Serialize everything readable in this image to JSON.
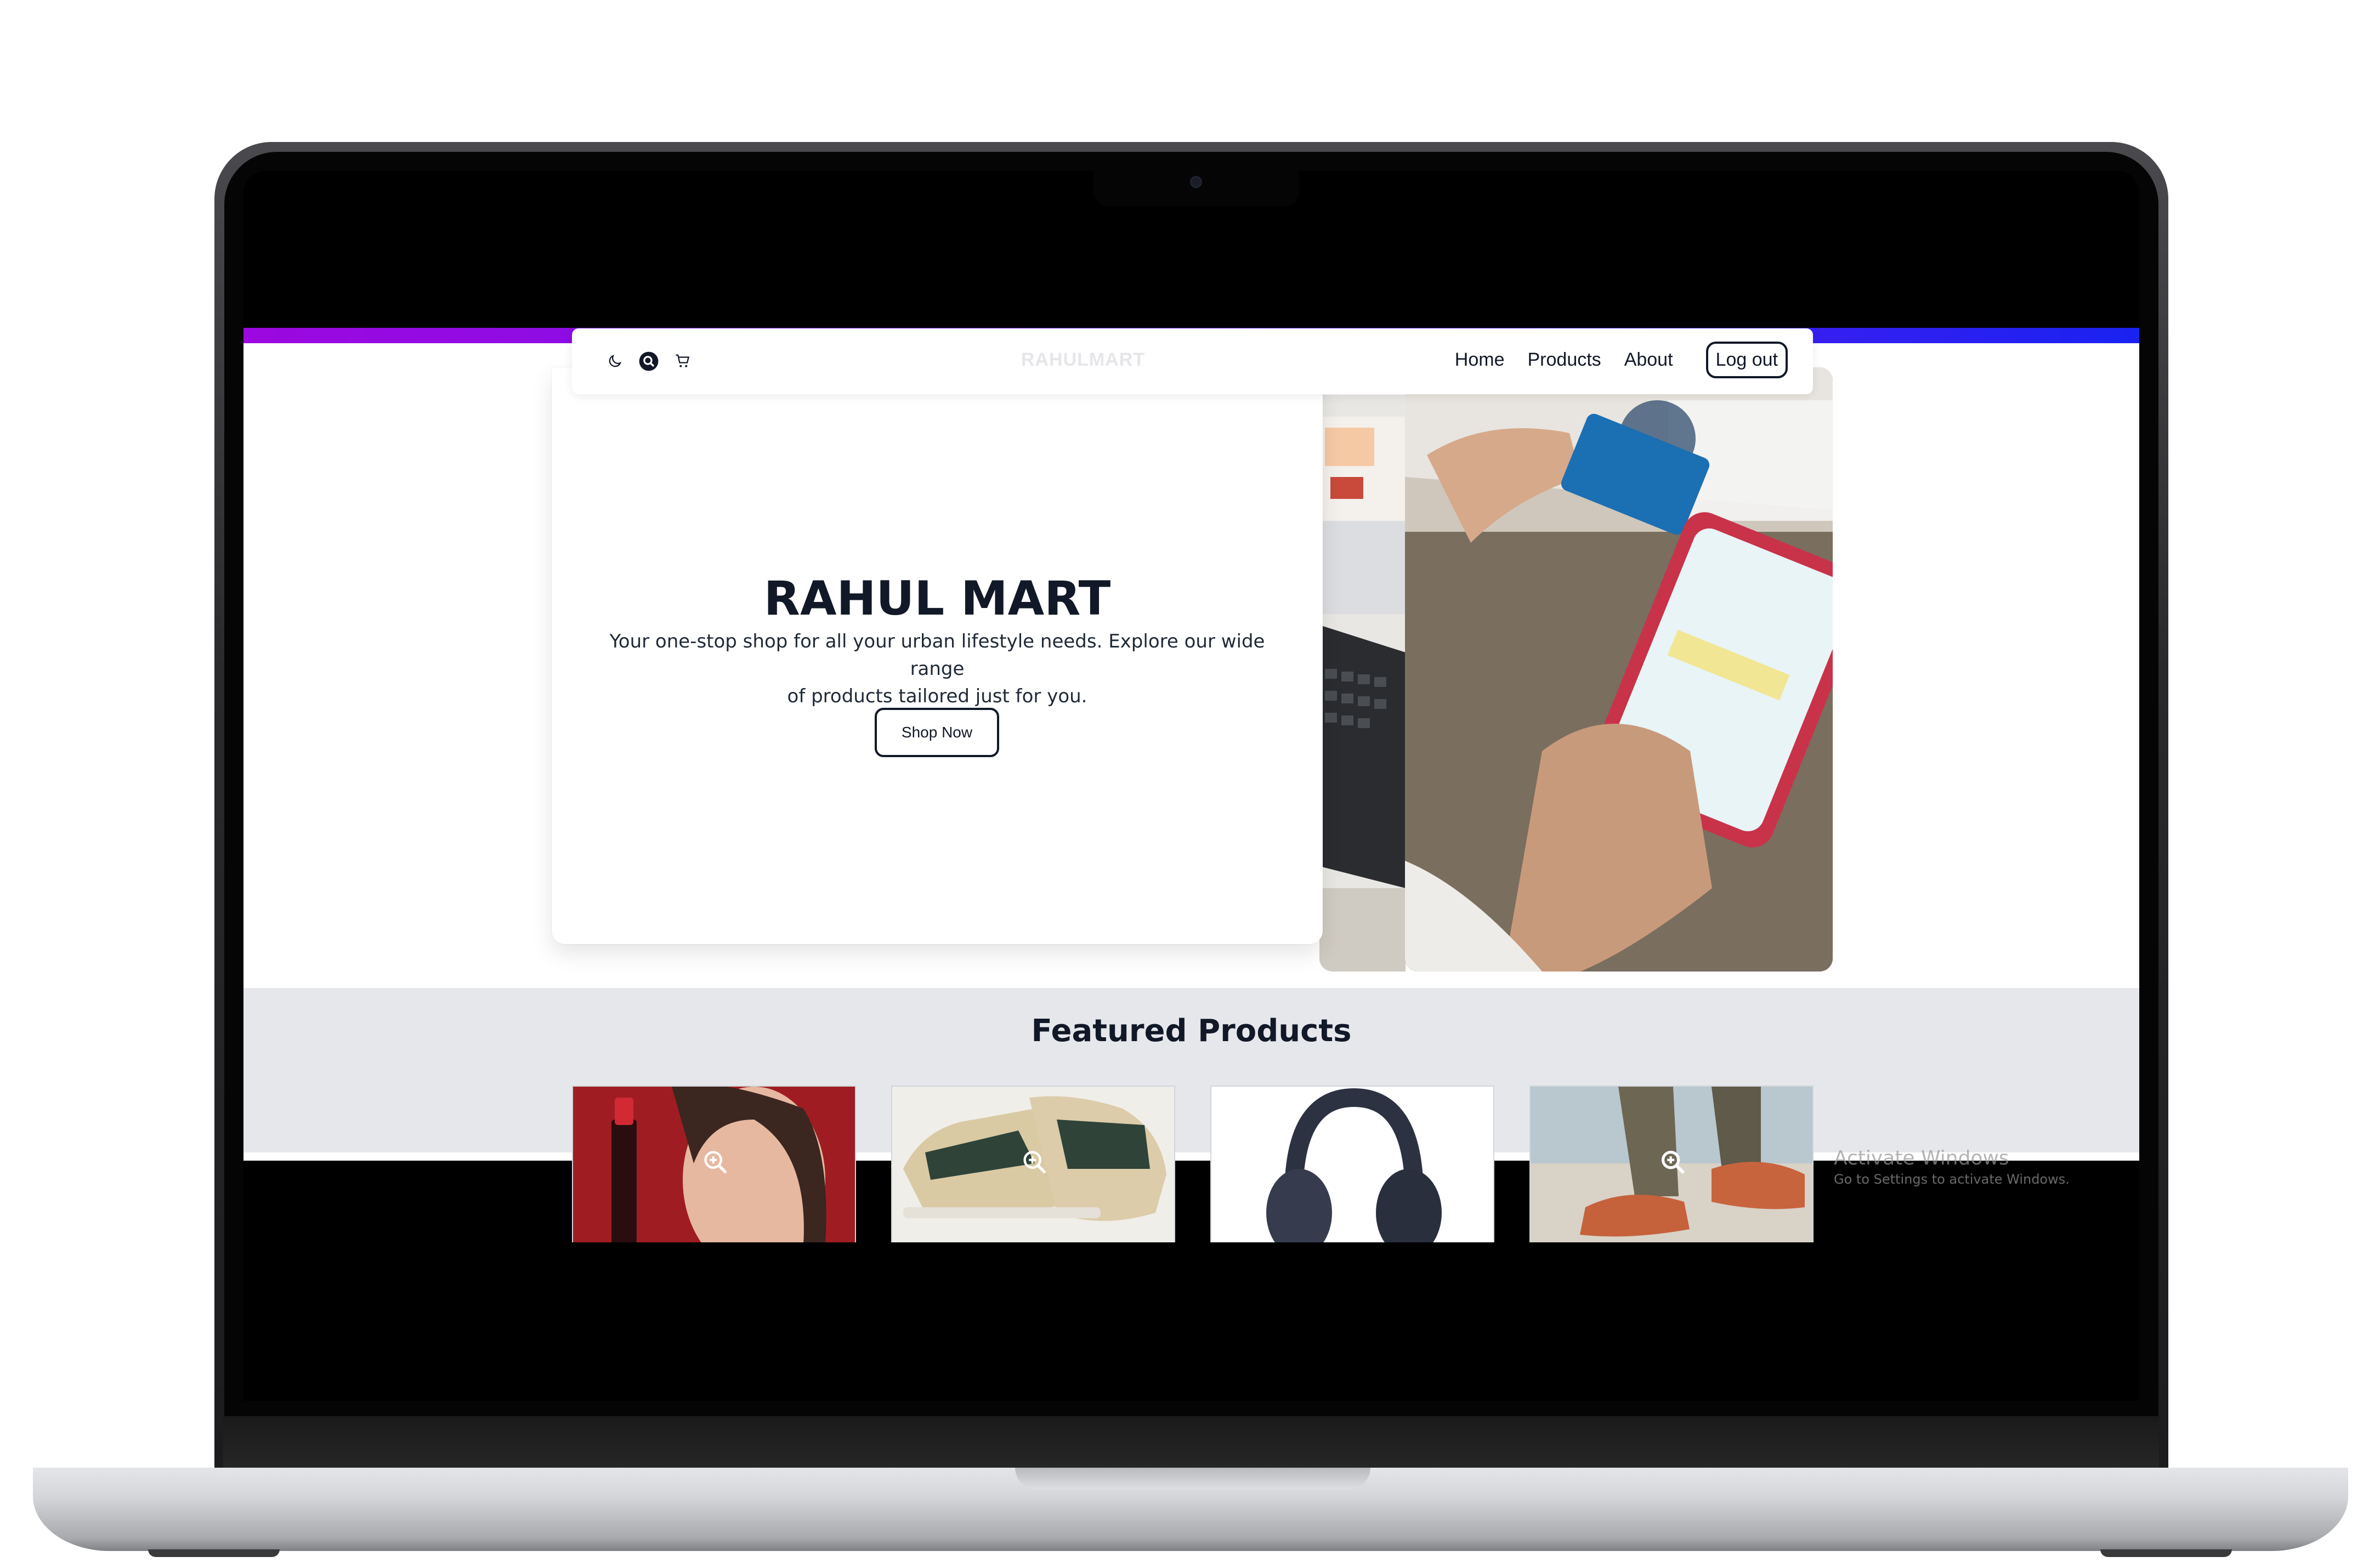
{
  "navbar": {
    "brand": "RAHULMART",
    "links": [
      "Home",
      "Products",
      "About"
    ],
    "logout_label": "Log out",
    "icons": [
      "moon-icon",
      "search-icon",
      "cart-icon"
    ]
  },
  "hero": {
    "title": "RAHUL MART",
    "subtitle_line1": "Your one-stop shop for all your urban lifestyle needs. Explore our wide range",
    "subtitle_line2": "of products tailored just for you.",
    "cta_label": "Shop Now"
  },
  "featured": {
    "title": "Featured Products",
    "products": [
      {
        "name": "lipstick-model",
        "bg": "#9f1d22"
      },
      {
        "name": "sneakers",
        "bg": "#f0eee9"
      },
      {
        "name": "headphones",
        "bg": "#ffffff"
      },
      {
        "name": "casual-shoes",
        "bg": "#d7d0c5"
      }
    ]
  },
  "windows_watermark": {
    "line1": "Activate Windows",
    "line2": "Go to Settings to activate Windows."
  },
  "colors": {
    "accent_gradient_start": "#9c08e0",
    "accent_gradient_end": "#1a22f0",
    "featured_bg": "#e5e7eb",
    "text_dark": "#111827"
  }
}
